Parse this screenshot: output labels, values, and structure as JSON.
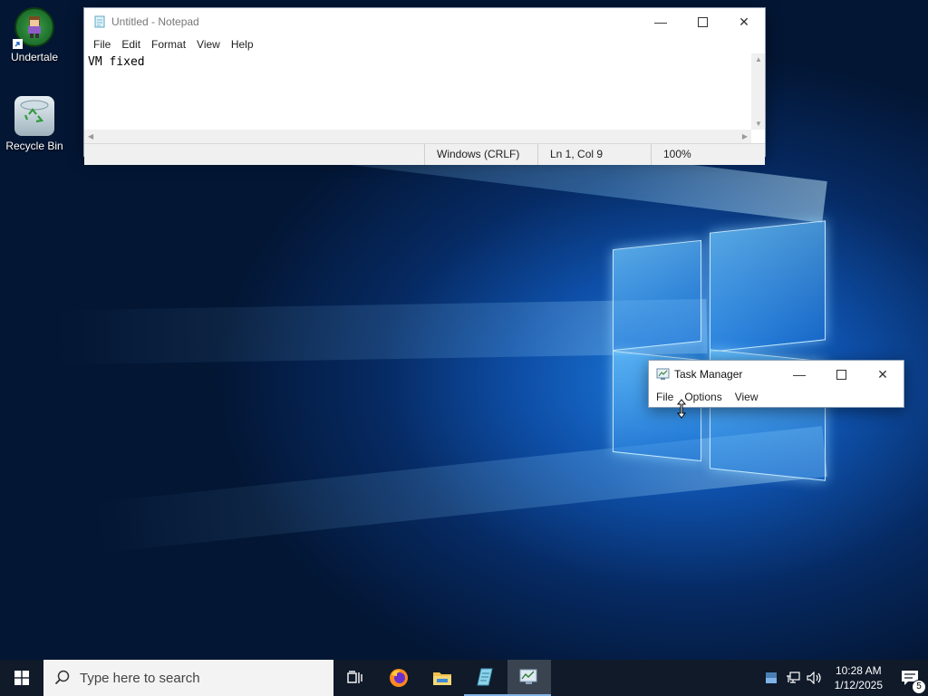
{
  "desktop": {
    "icons": [
      {
        "label": "Undertale"
      },
      {
        "label": "Recycle Bin"
      }
    ]
  },
  "notepad": {
    "title": "Untitled - Notepad",
    "menu": [
      "File",
      "Edit",
      "Format",
      "View",
      "Help"
    ],
    "content": "VM fixed",
    "status": {
      "line_ending": "Windows (CRLF)",
      "position": "Ln 1, Col 9",
      "zoom": "100%"
    }
  },
  "taskmanager": {
    "title": "Task Manager",
    "menu": [
      "File",
      "Options",
      "View"
    ]
  },
  "taskbar": {
    "search_placeholder": "Type here to search",
    "clock_time": "10:28 AM",
    "clock_date": "1/12/2025",
    "notification_count": "5"
  },
  "colors": {
    "taskbar_bg": "#101a29",
    "active_app_bg": "#3a4350",
    "desktop_accent": "#1d7fe0"
  }
}
